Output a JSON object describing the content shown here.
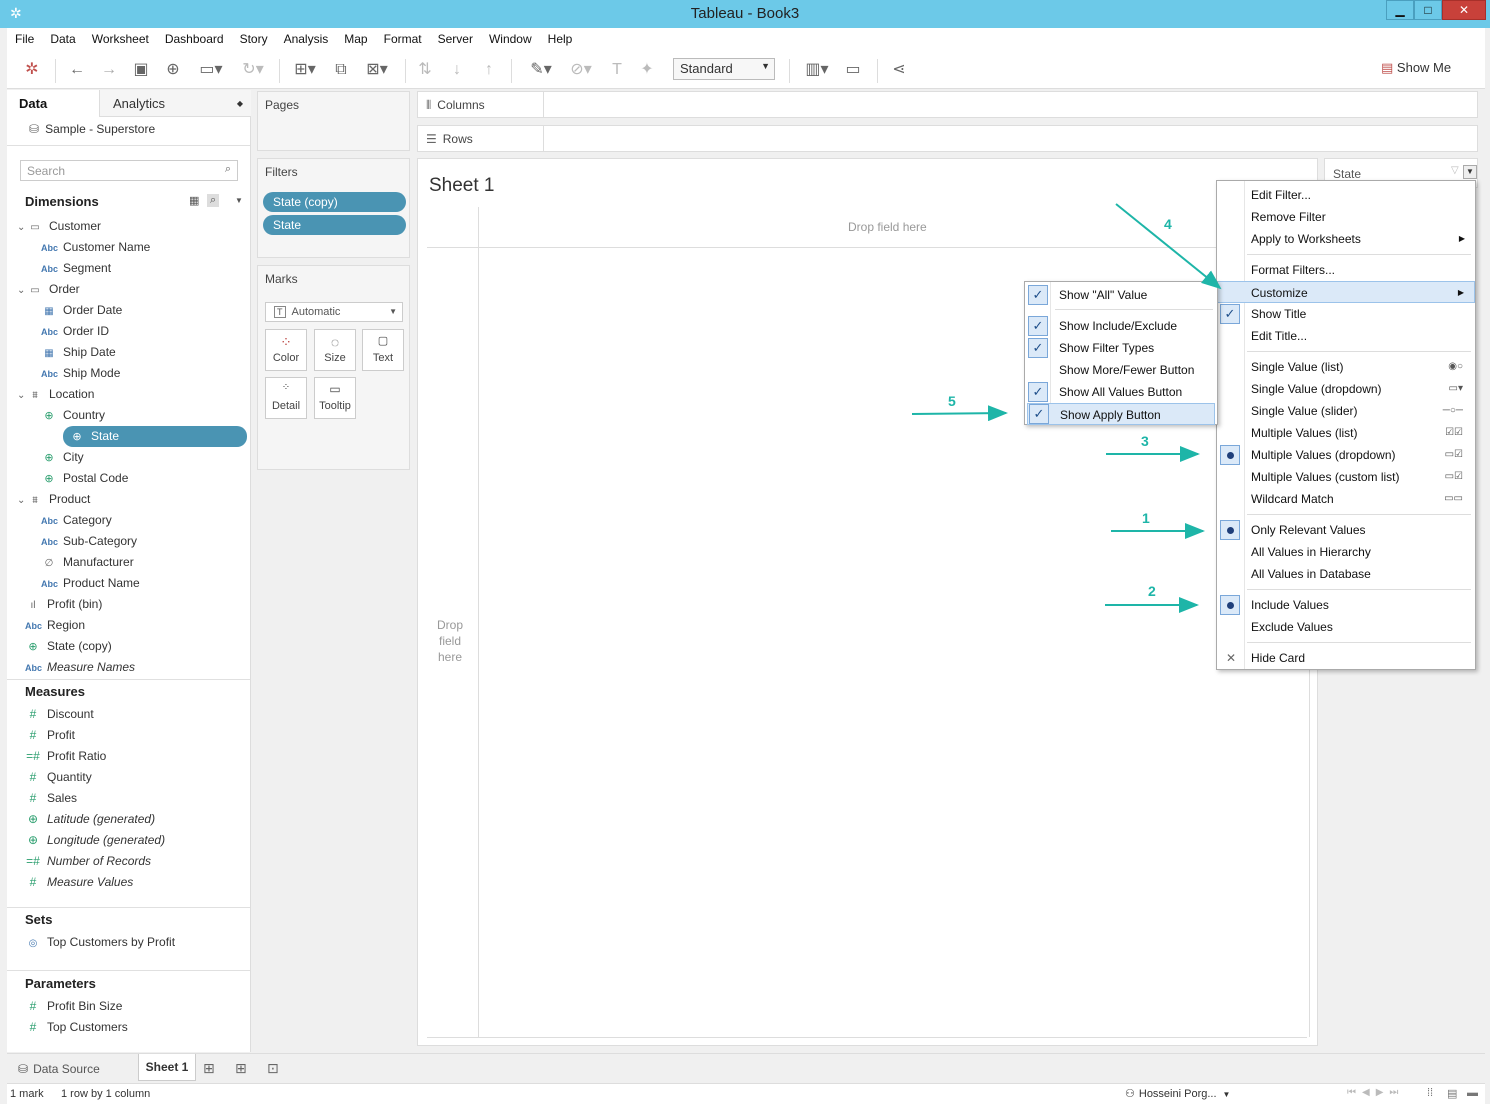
{
  "window": {
    "title": "Tableau - Book3"
  },
  "menubar": [
    "File",
    "Data",
    "Worksheet",
    "Dashboard",
    "Story",
    "Analysis",
    "Map",
    "Format",
    "Server",
    "Window",
    "Help"
  ],
  "toolbar": {
    "standard": "Standard",
    "show_me": "Show Me"
  },
  "data_pane": {
    "tab_data": "Data",
    "tab_analytics": "Analytics",
    "datasource": "Sample - Superstore",
    "search_placeholder": "Search",
    "dimensions_label": "Dimensions",
    "dimensions": [
      {
        "label": "Customer",
        "kind": "folder"
      },
      {
        "label": "Customer Name",
        "kind": "abc"
      },
      {
        "label": "Segment",
        "kind": "abc"
      },
      {
        "label": "Order",
        "kind": "folder"
      },
      {
        "label": "Order Date",
        "kind": "date"
      },
      {
        "label": "Order ID",
        "kind": "abc"
      },
      {
        "label": "Ship Date",
        "kind": "date"
      },
      {
        "label": "Ship Mode",
        "kind": "abc"
      },
      {
        "label": "Location",
        "kind": "hierarchy"
      },
      {
        "label": "Country",
        "kind": "geo"
      },
      {
        "label": "State",
        "kind": "geo"
      },
      {
        "label": "City",
        "kind": "geo"
      },
      {
        "label": "Postal Code",
        "kind": "geo"
      },
      {
        "label": "Product",
        "kind": "hierarchy"
      },
      {
        "label": "Category",
        "kind": "abc"
      },
      {
        "label": "Sub-Category",
        "kind": "abc"
      },
      {
        "label": "Manufacturer",
        "kind": "clip"
      },
      {
        "label": "Product Name",
        "kind": "abc"
      },
      {
        "label": "Profit (bin)",
        "kind": "bin"
      },
      {
        "label": "Region",
        "kind": "abc"
      },
      {
        "label": "State (copy)",
        "kind": "geo"
      },
      {
        "label": "Measure Names",
        "kind": "abc"
      }
    ],
    "measures_label": "Measures",
    "measures": [
      "Discount",
      "Profit",
      "Profit Ratio",
      "Quantity",
      "Sales",
      "Latitude (generated)",
      "Longitude (generated)",
      "Number of Records",
      "Measure Values"
    ],
    "sets_label": "Sets",
    "sets": [
      "Top Customers by Profit"
    ],
    "parameters_label": "Parameters",
    "parameters": [
      "Profit Bin Size",
      "Top Customers"
    ]
  },
  "pages_label": "Pages",
  "filters_label": "Filters",
  "filters": [
    "State (copy)",
    "State"
  ],
  "marks": {
    "label": "Marks",
    "type": "Automatic",
    "buttons": [
      "Color",
      "Size",
      "Text",
      "Detail",
      "Tooltip"
    ]
  },
  "shelves": {
    "columns": "Columns",
    "rows": "Rows"
  },
  "sheet": {
    "title": "Sheet 1",
    "drop_top": "Drop field here",
    "drop_left": "Drop field here"
  },
  "filter_card": {
    "title": "State"
  },
  "context_menu": [
    "Edit Filter...",
    "Remove Filter",
    "Apply to Worksheets",
    "Format Filters...",
    "Customize",
    "Show Title",
    "Edit Title...",
    "Single Value (list)",
    "Single Value (dropdown)",
    "Single Value (slider)",
    "Multiple Values (list)",
    "Multiple Values (dropdown)",
    "Multiple Values (custom list)",
    "Wildcard Match",
    "Only Relevant Values",
    "All Values in Hierarchy",
    "All Values in Database",
    "Include Values",
    "Exclude Values",
    "Hide Card"
  ],
  "customize_menu": [
    "Show \"All\" Value",
    "Show Include/Exclude",
    "Show Filter Types",
    "Show More/Fewer Button",
    "Show All Values Button",
    "Show Apply Button"
  ],
  "annotations": [
    "1",
    "2",
    "3",
    "4",
    "5"
  ],
  "bottom_tabs": {
    "datasource": "Data Source",
    "sheet": "Sheet 1"
  },
  "status": {
    "marks": "1 mark",
    "rows": "1 row by 1 column",
    "user": "Hosseini Porg..."
  },
  "colors": {
    "titlebar": "#6cc9e8",
    "pill": "#4a94b3",
    "annotation": "#1eb5a8"
  }
}
